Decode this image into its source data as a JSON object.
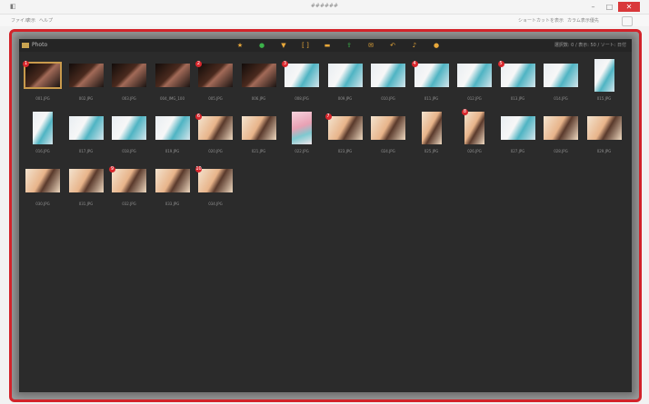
{
  "window": {
    "title": "######",
    "app_icon": "app-icon",
    "controls": {
      "minimize": "–",
      "maximize": "□",
      "close": "✕"
    }
  },
  "menubar": {
    "items": [
      {
        "label": "ファイル"
      },
      {
        "label": "表示"
      },
      {
        "label": "ヘルプ"
      }
    ],
    "right_items": [
      {
        "label": "ショートカットを表示"
      },
      {
        "label": "カラム表示優先"
      }
    ],
    "hint_icon": "help-icon"
  },
  "toolbar": {
    "folder_label": "Photo",
    "status_text": "選択数: 0 / 表示: 50 / ソート: 日付",
    "tools": [
      {
        "icon": "star-icon",
        "glyph": "★",
        "color": "#e8a83a"
      },
      {
        "icon": "circle-icon",
        "glyph": "●",
        "color": "#3bb24a"
      },
      {
        "icon": "filter-icon",
        "glyph": "▼",
        "color": "#e8a83a"
      },
      {
        "icon": "brackets-icon",
        "glyph": "[ ]",
        "color": "#e8a83a"
      },
      {
        "icon": "folder-icon",
        "glyph": "▬",
        "color": "#e8a83a"
      },
      {
        "icon": "export-icon",
        "glyph": "⇪",
        "color": "#3bb24a"
      },
      {
        "icon": "mail-icon",
        "glyph": "✉",
        "color": "#e8a83a"
      },
      {
        "icon": "rotate-icon",
        "glyph": "↶",
        "color": "#e8a83a"
      },
      {
        "icon": "music-icon",
        "glyph": "♪",
        "color": "#e8a83a"
      },
      {
        "icon": "info-icon",
        "glyph": "●",
        "color": "#e8a83a"
      }
    ]
  },
  "thumbnails": [
    {
      "name": "001.JPG",
      "tone": "dark",
      "orient": "l",
      "badge": "1",
      "selected": true
    },
    {
      "name": "002.JPG",
      "tone": "dark",
      "orient": "l",
      "badge": "",
      "selected": false
    },
    {
      "name": "003.JPG",
      "tone": "dark",
      "orient": "l",
      "badge": "",
      "selected": false
    },
    {
      "name": "004_IMG_100",
      "tone": "dark",
      "orient": "l",
      "badge": "",
      "selected": false
    },
    {
      "name": "005.JPG",
      "tone": "dark",
      "orient": "l",
      "badge": "2",
      "selected": false
    },
    {
      "name": "006.JPG",
      "tone": "dark",
      "orient": "l",
      "badge": "",
      "selected": false
    },
    {
      "name": "008.JPG",
      "tone": "light",
      "orient": "l",
      "badge": "3",
      "selected": false
    },
    {
      "name": "009.JPG",
      "tone": "light",
      "orient": "l",
      "badge": "",
      "selected": false
    },
    {
      "name": "010.JPG",
      "tone": "light",
      "orient": "l",
      "badge": "",
      "selected": false
    },
    {
      "name": "011.JPG",
      "tone": "light",
      "orient": "l",
      "badge": "4",
      "selected": false
    },
    {
      "name": "012.JPG",
      "tone": "light",
      "orient": "l",
      "badge": "",
      "selected": false
    },
    {
      "name": "013.JPG",
      "tone": "light",
      "orient": "l",
      "badge": "5",
      "selected": false
    },
    {
      "name": "014.JPG",
      "tone": "light",
      "orient": "l",
      "badge": "",
      "selected": false
    },
    {
      "name": "015.JPG",
      "tone": "light",
      "orient": "p",
      "badge": "",
      "selected": false
    },
    {
      "name": "016.JPG",
      "tone": "light",
      "orient": "p",
      "badge": "",
      "selected": false
    },
    {
      "name": "017.JPG",
      "tone": "light",
      "orient": "l",
      "badge": "",
      "selected": false
    },
    {
      "name": "018.JPG",
      "tone": "light",
      "orient": "l",
      "badge": "",
      "selected": false
    },
    {
      "name": "019.JPG",
      "tone": "light",
      "orient": "l",
      "badge": "",
      "selected": false
    },
    {
      "name": "020.JPG",
      "tone": "warm",
      "orient": "l",
      "badge": "6",
      "selected": false
    },
    {
      "name": "021.JPG",
      "tone": "warm",
      "orient": "l",
      "badge": "",
      "selected": false
    },
    {
      "name": "022.JPG",
      "tone": "pink",
      "orient": "p",
      "badge": "",
      "selected": false
    },
    {
      "name": "023.JPG",
      "tone": "warm",
      "orient": "l",
      "badge": "7",
      "selected": false
    },
    {
      "name": "024.JPG",
      "tone": "warm",
      "orient": "l",
      "badge": "",
      "selected": false
    },
    {
      "name": "025.JPG",
      "tone": "warm",
      "orient": "p",
      "badge": "",
      "selected": false
    },
    {
      "name": "026.JPG",
      "tone": "warm",
      "orient": "p",
      "badge": "8",
      "selected": false
    },
    {
      "name": "027.JPG",
      "tone": "light",
      "orient": "l",
      "badge": "",
      "selected": false
    },
    {
      "name": "028.JPG",
      "tone": "warm",
      "orient": "l",
      "badge": "",
      "selected": false
    },
    {
      "name": "029.JPG",
      "tone": "warm",
      "orient": "l",
      "badge": "",
      "selected": false
    },
    {
      "name": "030.JPG",
      "tone": "warm",
      "orient": "l",
      "badge": "",
      "selected": false
    },
    {
      "name": "031.JPG",
      "tone": "warm",
      "orient": "l",
      "badge": "",
      "selected": false
    },
    {
      "name": "032.JPG",
      "tone": "warm",
      "orient": "l",
      "badge": "9",
      "selected": false
    },
    {
      "name": "033.JPG",
      "tone": "warm",
      "orient": "l",
      "badge": "",
      "selected": false
    },
    {
      "name": "034.JPG",
      "tone": "warm",
      "orient": "l",
      "badge": "10",
      "selected": false
    }
  ],
  "colors": {
    "accent_red": "#d2232a",
    "panel_bg": "#2b2b2b",
    "selection": "#c99a4c"
  }
}
